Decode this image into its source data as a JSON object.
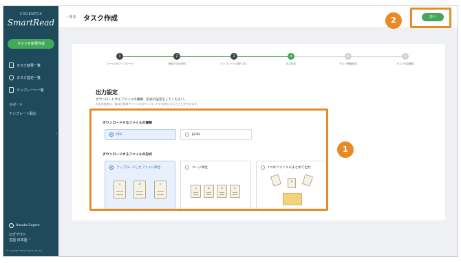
{
  "sidebar": {
    "brand_small": "COGENTDX",
    "brand_big": "SmartRead",
    "new_task_label": "タスクを新規作成",
    "items": [
      {
        "label": "タスク結果一覧",
        "icon": "document-icon"
      },
      {
        "label": "タスク設定一覧",
        "icon": "settings-icon"
      },
      {
        "label": "テンプレート一覧",
        "icon": "template-icon"
      }
    ],
    "links": [
      "サポート",
      "テンプレート取込"
    ],
    "collapse_symbol": "‹",
    "user_name": "Hanako Cogent",
    "logout_label": "ログアウト",
    "language_label": "言語  日本語 ⌃",
    "copyright": "© Copyright 2023 Cogent Labs Inc."
  },
  "header": {
    "back_label": "‹ 戻る",
    "title": "タスク作成",
    "next_label": "次へ"
  },
  "stepper": {
    "steps": [
      {
        "num": "1",
        "label": "ファイルをアップロード",
        "state": "done"
      },
      {
        "num": "2",
        "label": "読取方法の説明",
        "state": "done"
      },
      {
        "num": "3",
        "label": "テンプレートの割り当て",
        "state": "done"
      },
      {
        "num": "4",
        "label": "出力設定",
        "state": "current"
      },
      {
        "num": "5",
        "label": "タスク情報設定",
        "state": "todo"
      },
      {
        "num": "6",
        "label": "タスク内容確認",
        "state": "todo"
      }
    ]
  },
  "output": {
    "title": "出力設定",
    "desc": "ダウンロードするファイルの種類、形式の設定をしてください。",
    "note": "※出力設定は、後ほど結果ファイルをダウンロードする時にも行うことができます。",
    "type_label": "ダウンロードするファイルの種類",
    "type_options": [
      "PDF",
      "JSON"
    ],
    "format_label": "ダウンロードするファイルの形式",
    "format_options": [
      "アップロードしたファイル単位",
      "ページ単位",
      "1つのファイルにまとめて出力"
    ],
    "doc_letters": [
      "A",
      "B",
      "C"
    ]
  },
  "annotations": {
    "badge1": "1",
    "badge2": "2",
    "color": "#e88a26"
  }
}
